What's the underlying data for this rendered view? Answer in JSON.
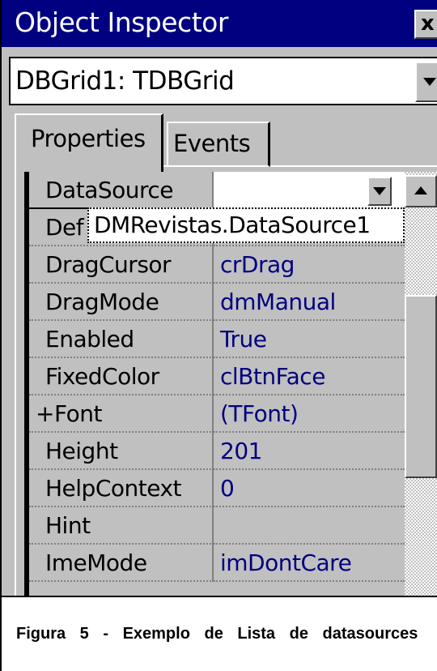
{
  "window": {
    "title": "Object Inspector",
    "close_label": "x"
  },
  "object_selector": {
    "value": "DBGrid1: TDBGrid"
  },
  "tabs": [
    {
      "label": "Properties",
      "active": true
    },
    {
      "label": "Events",
      "active": false
    }
  ],
  "properties": [
    {
      "name": "DataSource",
      "value": ""
    },
    {
      "name": "Def",
      "value": ""
    },
    {
      "name": "DragCursor",
      "value": "crDrag"
    },
    {
      "name": "DragMode",
      "value": "dmManual"
    },
    {
      "name": "Enabled",
      "value": "True"
    },
    {
      "name": "FixedColor",
      "value": "clBtnFace"
    },
    {
      "name": "+Font",
      "value": "(TFont)"
    },
    {
      "name": "Height",
      "value": "201"
    },
    {
      "name": "HelpContext",
      "value": "0"
    },
    {
      "name": "Hint",
      "value": ""
    },
    {
      "name": "ImeMode",
      "value": "imDontCare"
    }
  ],
  "dropdown": {
    "items": [
      "DMRevistas.DataSource1"
    ]
  },
  "caption": "Figura 5 - Exemplo de Lista de datasources",
  "colors": {
    "title_bar": "#000080",
    "value_text": "#000080",
    "face": "#c0c0c0"
  }
}
